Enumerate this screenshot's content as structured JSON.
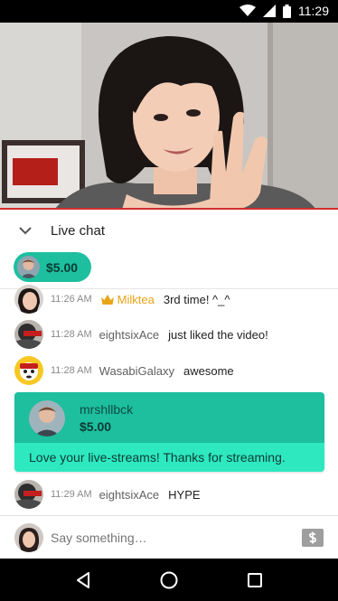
{
  "status_bar": {
    "time": "11:29",
    "icons": [
      "wifi-icon",
      "signal-icon",
      "battery-icon"
    ]
  },
  "video": {
    "progress_color": "#d32f2f"
  },
  "chat_header": {
    "title": "Live chat",
    "collapse_icon": "chevron-down-icon"
  },
  "ticker": {
    "amount": "$5.00",
    "color": "#1dbf9f"
  },
  "messages": [
    {
      "time": "11:26 AM",
      "author": "Milktea",
      "badge": "crown-icon",
      "text": "3rd time! ^_^"
    },
    {
      "time": "11:28 AM",
      "author": "eightsixAce",
      "text": "just liked the video!"
    },
    {
      "time": "11:28 AM",
      "author": "WasabiGalaxy",
      "text": "awesome"
    },
    {
      "time": "11:29 AM",
      "author": "eightsixAce",
      "text": "HYPE"
    }
  ],
  "paid_message": {
    "author": "mrshllbck",
    "amount": "$5.00",
    "text": "Love your live-streams! Thanks for streaming.",
    "header_color": "#1dbf9f",
    "body_color": "#2ee8c0"
  },
  "chat_input": {
    "placeholder": "Say something…",
    "send_money_icon": "dollar-icon"
  },
  "nav": {
    "icons": [
      "back-icon",
      "home-icon",
      "recents-icon"
    ]
  },
  "colors": {
    "member_name": "#e8a317",
    "accent_red": "#d32f2f"
  }
}
